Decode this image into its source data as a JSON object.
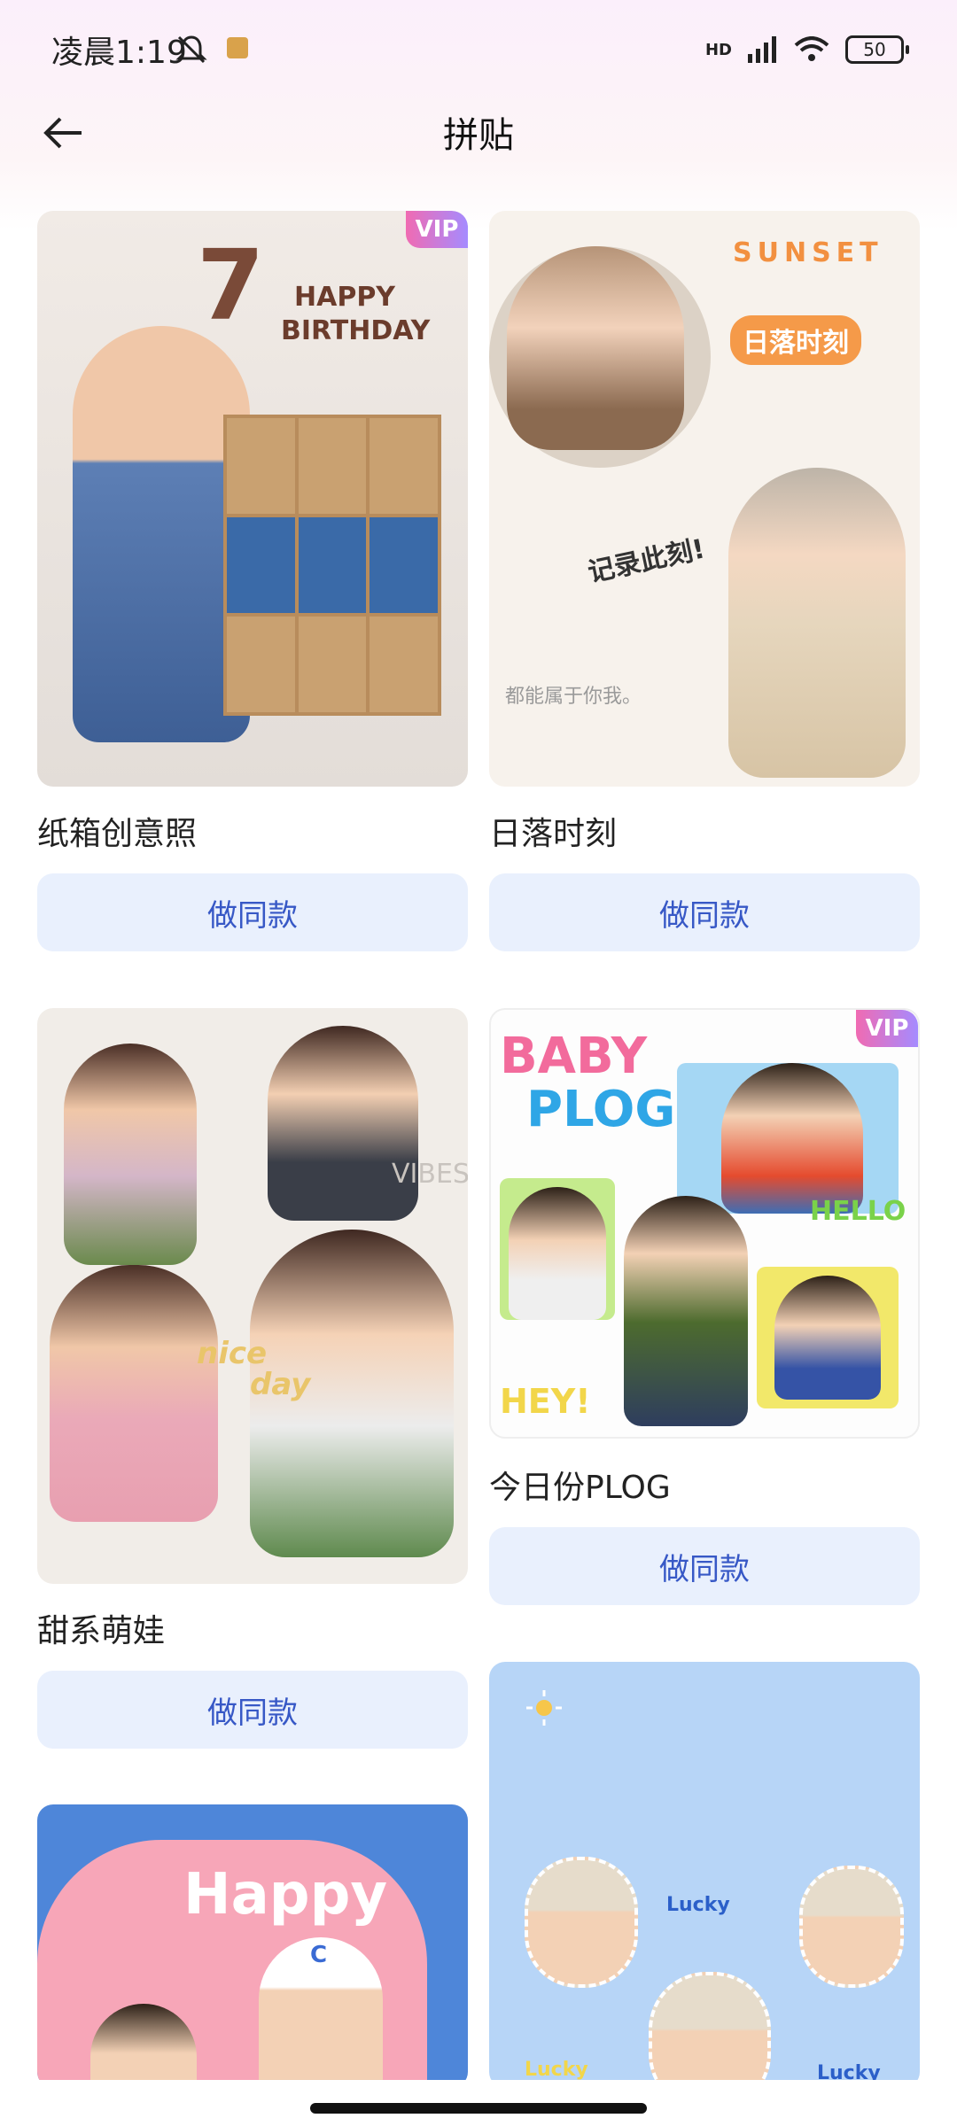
{
  "status_bar": {
    "time": "凌晨1:19",
    "network": "HD",
    "battery": "50"
  },
  "header": {
    "title": "拼贴",
    "back_icon": "back-arrow-icon"
  },
  "templates": [
    {
      "title": "纸箱创意照",
      "button": "做同款",
      "vip": true,
      "vip_label": "VIP",
      "art_lines": [
        "HAPPY",
        "BIRTHDAY",
        "7"
      ]
    },
    {
      "title": "日落时刻",
      "button": "做同款",
      "vip": false,
      "art_lines": [
        "SUNSET",
        "日落时刻",
        "记录此刻!",
        "都能属于你我。"
      ]
    },
    {
      "title": "甜系萌娃",
      "button": "做同款",
      "vip": false,
      "art_lines": [
        "nice",
        "day",
        "VIBES"
      ]
    },
    {
      "title": "今日份PLOG",
      "button": "做同款",
      "vip": true,
      "vip_label": "VIP",
      "art_lines": [
        "BABY",
        "PLOG",
        "HELLO",
        "HEY!"
      ]
    },
    {
      "title": "",
      "button": "",
      "vip": false,
      "art_lines": [
        "Happy",
        "C"
      ]
    },
    {
      "title": "",
      "button": "",
      "vip": false,
      "art_lines": [
        "Lucky",
        "Lucky",
        "Lucky"
      ]
    }
  ],
  "colors": {
    "button_bg": "#e9f0fd",
    "button_text": "#3758c6",
    "vip_gradient": [
      "#f06bb2",
      "#a58bff"
    ]
  }
}
